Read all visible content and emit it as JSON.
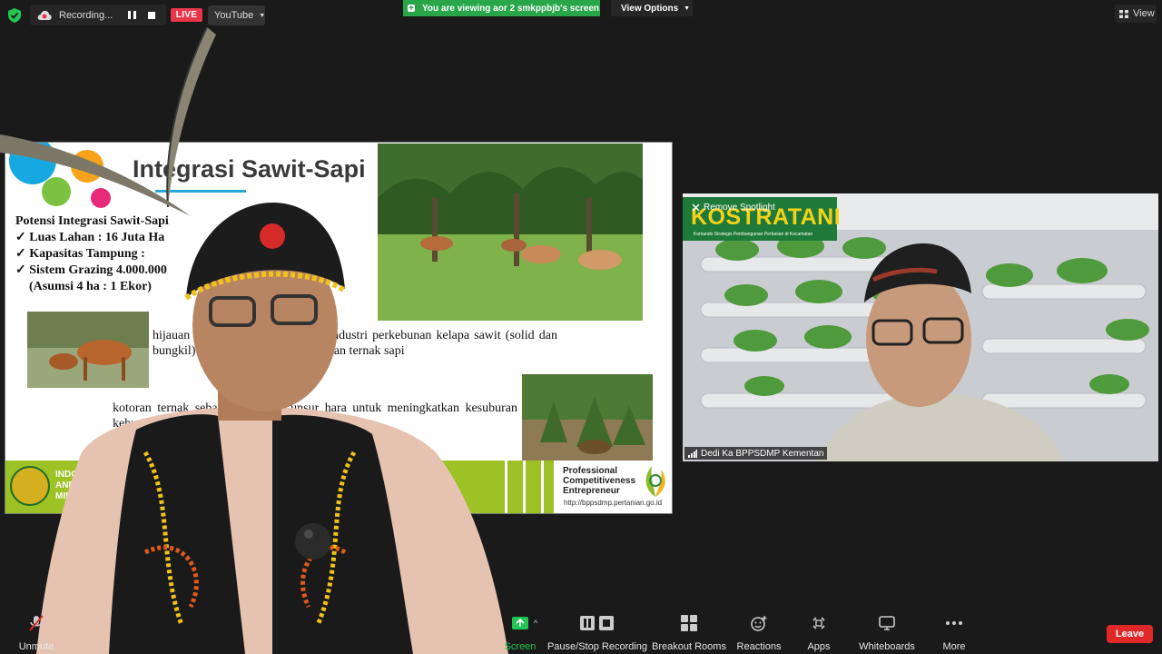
{
  "top_bar": {
    "recording_text": "Recording...",
    "live_badge": "LIVE",
    "stream_platform": "YouTube",
    "viewing_banner": "You are viewing aor 2 smkppbjb's screen",
    "view_options": "View Options",
    "view_button": "View"
  },
  "slide": {
    "title": "Integrasi Sawit-Sapi",
    "bullets": [
      "Potensi Integrasi Sawit-Sapi",
      "✓ Luas Lahan : 16 Juta Ha",
      "✓ Kapasitas Tampung :",
      "✓ Sistem Grazing 4.000.000",
      "(Asumsi 4 ha : 1 Ekor)"
    ],
    "para1": "hijauan pakan dan hasil samping industri perkebunan kelapa sawit (solid dan bungkil) itu merupakan sumber pakan ternak sapi",
    "para2": "kotoran ternak sebagai penyedia unsur hara untuk meningkatkan kesuburan kebun kelapa sawit dan pupuk organik",
    "footer_org": [
      "INDONESIAN AGENCY FOR",
      "AND HUMAN RESOURCE",
      "MINISTRY OF AGRICULTURE"
    ],
    "pce": [
      "Professional",
      "Competitiveness",
      "Entrepreneur"
    ],
    "url": "http://bppsdmp.pertanian.go.id"
  },
  "video_tile": {
    "remove_spotlight": "Remove Spotlight",
    "logo_text": "KOSTRATANI",
    "logo_sub": "Komando Strategis Pembangunan Pertanian di Kecamatan",
    "participant_name": "Dedi Ka BPPSDMP Kementan"
  },
  "toolbar": {
    "unmute": "Unmute",
    "share_screen": "Screen",
    "pause_stop_recording": "Pause/Stop Recording",
    "breakout_rooms": "Breakout Rooms",
    "reactions": "Reactions",
    "apps": "Apps",
    "whiteboards": "Whiteboards",
    "more": "More",
    "leave": "Leave"
  },
  "colors": {
    "live_red": "#e8364a",
    "banner_green": "#29a64a",
    "leave_red": "#e02828",
    "slide_green": "#9cc225"
  }
}
